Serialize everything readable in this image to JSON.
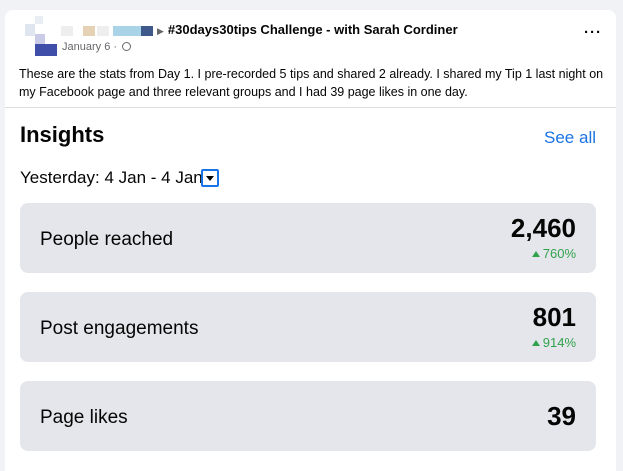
{
  "post": {
    "header": "#30days30tips Challenge - with Sarah Cordiner",
    "date": "January 6",
    "body": "These are the stats from Day 1. I pre-recorded 5 tips and shared 2 already. I shared my Tip 1 last night on my Facebook page and three relevant groups and I had 39 page likes in one day.",
    "more_icon": "more-horizontal-icon"
  },
  "insights": {
    "title": "Insights",
    "see_all": "See all",
    "date_label": "Yesterday:",
    "date_range": "4 Jan - 4 Jan",
    "metrics": [
      {
        "label": "People reached",
        "value": "2,460",
        "change": "760%"
      },
      {
        "label": "Post engagements",
        "value": "801",
        "change": "914%"
      },
      {
        "label": "Page likes",
        "value": "39"
      }
    ]
  },
  "colors": {
    "accent": "#1b74e4",
    "positive": "#31a24c",
    "card_bg": "#e4e6eb"
  }
}
